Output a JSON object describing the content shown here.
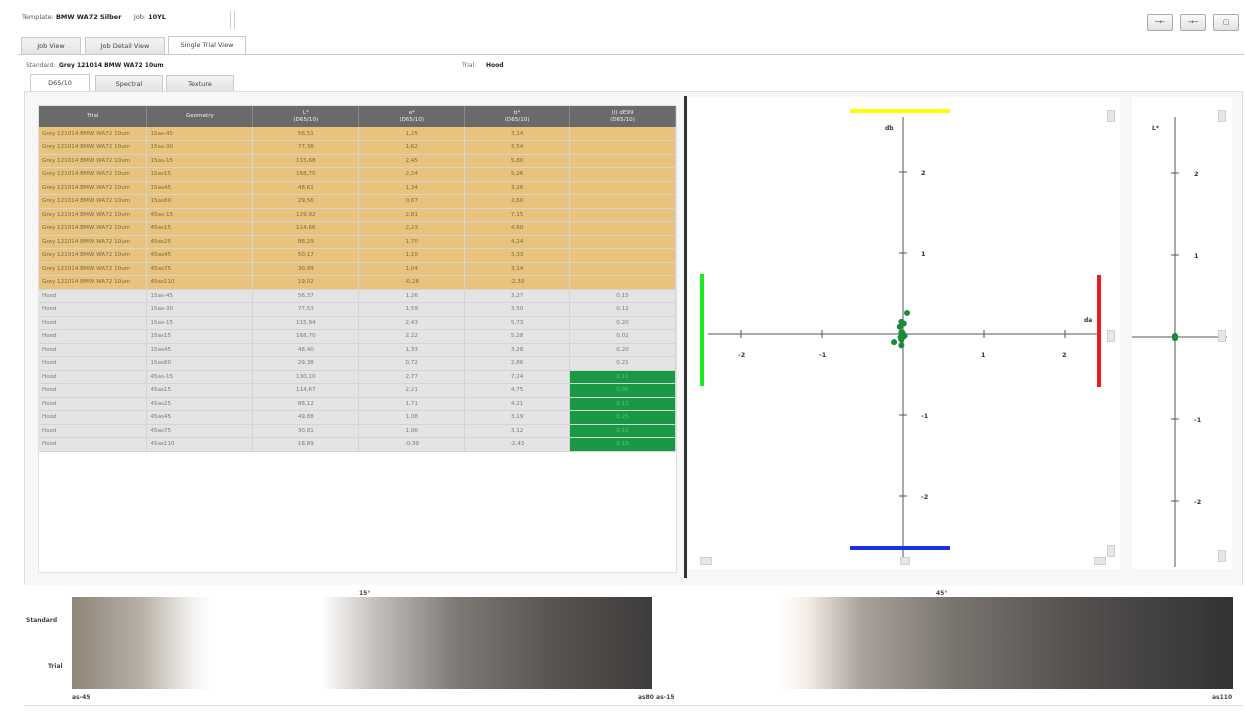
{
  "header": {
    "template_label": "Template:",
    "template_value": "BMW WA72 Silber",
    "job_label": "Job:",
    "job_value": "10YL",
    "tool_buttons": [
      "─←",
      "→─",
      "▢"
    ]
  },
  "tabs": [
    "Job View",
    "Job Detail View",
    "Single Trial View"
  ],
  "standard_label": "Standard:",
  "standard_value": "Grey 121014 BMW WA72 10um",
  "trial_label": "Trial:",
  "trial_value": "Hood",
  "subtabs": [
    "D65/10",
    "Spectral",
    "Texture"
  ],
  "table": {
    "headers": [
      {
        "l1": "Trial",
        "l2": ""
      },
      {
        "l1": "Geometry",
        "l2": ""
      },
      {
        "l1": "L*",
        "l2": "(D65/10)"
      },
      {
        "l1": "a*",
        "l2": "(D65/10)"
      },
      {
        "l1": "b*",
        "l2": "(D65/10)"
      },
      {
        "l1": "(I) dE99",
        "l2": "(D65/10)"
      }
    ],
    "rows": [
      {
        "trial": "Grey 121014 BMW WA72 10um",
        "geo": "15as-45",
        "L": "56,51",
        "a": "1,25",
        "b": "3,14",
        "de": "",
        "kind": "std"
      },
      {
        "trial": "Grey 121014 BMW WA72 10um",
        "geo": "15as-30",
        "L": "77,38",
        "a": "1,62",
        "b": "3,54",
        "de": "",
        "kind": "std"
      },
      {
        "trial": "Grey 121014 BMW WA72 10um",
        "geo": "15as-15",
        "L": "115,68",
        "a": "2,45",
        "b": "5,80",
        "de": "",
        "kind": "std"
      },
      {
        "trial": "Grey 121014 BMW WA72 10um",
        "geo": "15as15",
        "L": "168,70",
        "a": "2,24",
        "b": "5,26",
        "de": "",
        "kind": "std"
      },
      {
        "trial": "Grey 121014 BMW WA72 10um",
        "geo": "15as45",
        "L": "48,61",
        "a": "1,34",
        "b": "3,26",
        "de": "",
        "kind": "std"
      },
      {
        "trial": "Grey 121014 BMW WA72 10um",
        "geo": "15as80",
        "L": "29,56",
        "a": "0,67",
        "b": "2,60",
        "de": "",
        "kind": "std"
      },
      {
        "trial": "Grey 121014 BMW WA72 10um",
        "geo": "45as-15",
        "L": "129,92",
        "a": "2,81",
        "b": "7,15",
        "de": "",
        "kind": "std"
      },
      {
        "trial": "Grey 121014 BMW WA72 10um",
        "geo": "45as15",
        "L": "114,66",
        "a": "2,23",
        "b": "4,60",
        "de": "",
        "kind": "std"
      },
      {
        "trial": "Grey 121014 BMW WA72 10um",
        "geo": "45as25",
        "L": "88,29",
        "a": "1,70",
        "b": "4,24",
        "de": "",
        "kind": "std"
      },
      {
        "trial": "Grey 121014 BMW WA72 10um",
        "geo": "45as45",
        "L": "50,17",
        "a": "1,10",
        "b": "3,33",
        "de": "",
        "kind": "std"
      },
      {
        "trial": "Grey 121014 BMW WA72 10um",
        "geo": "45as75",
        "L": "30,99",
        "a": "1,04",
        "b": "3,14",
        "de": "",
        "kind": "std"
      },
      {
        "trial": "Grey 121014 BMW WA72 10um",
        "geo": "45as110",
        "L": "19,02",
        "a": "-0,28",
        "b": "-2,33",
        "de": "",
        "kind": "std"
      },
      {
        "trial": "Hood",
        "geo": "15as-45",
        "L": "56,37",
        "a": "1,26",
        "b": "3,27",
        "de": "0,15",
        "kind": "trl"
      },
      {
        "trial": "Hood",
        "geo": "15as-30",
        "L": "77,53",
        "a": "1,59",
        "b": "3,50",
        "de": "0,12",
        "kind": "trl"
      },
      {
        "trial": "Hood",
        "geo": "15as-15",
        "L": "115,94",
        "a": "2,43",
        "b": "5,73",
        "de": "0,20",
        "kind": "trl"
      },
      {
        "trial": "Hood",
        "geo": "15as15",
        "L": "168,70",
        "a": "2,22",
        "b": "5,28",
        "de": "0,02",
        "kind": "trl"
      },
      {
        "trial": "Hood",
        "geo": "15as45",
        "L": "48,40",
        "a": "1,33",
        "b": "3,28",
        "de": "0,20",
        "kind": "trl"
      },
      {
        "trial": "Hood",
        "geo": "15as80",
        "L": "29,38",
        "a": "0,72",
        "b": "2,86",
        "de": "0,21",
        "kind": "trl"
      },
      {
        "trial": "Hood",
        "geo": "45as-15",
        "L": "130,10",
        "a": "2,77",
        "b": "7,24",
        "de": "0,11",
        "kind": "trl",
        "green": true
      },
      {
        "trial": "Hood",
        "geo": "45as15",
        "L": "114,67",
        "a": "2,21",
        "b": "4,75",
        "de": "0,05",
        "kind": "trl",
        "green": true
      },
      {
        "trial": "Hood",
        "geo": "45as25",
        "L": "88,12",
        "a": "1,71",
        "b": "4,21",
        "de": "0,12",
        "kind": "trl",
        "green": true
      },
      {
        "trial": "Hood",
        "geo": "45as45",
        "L": "49,88",
        "a": "1,08",
        "b": "3,19",
        "de": "0,25",
        "kind": "trl",
        "green": true
      },
      {
        "trial": "Hood",
        "geo": "45as75",
        "L": "30,81",
        "a": "1,06",
        "b": "3,12",
        "de": "0,15",
        "kind": "trl",
        "green": true
      },
      {
        "trial": "Hood",
        "geo": "45as110",
        "L": "18,89",
        "a": "-0,39",
        "b": "-2,43",
        "de": "0,18",
        "kind": "trl",
        "green": true
      }
    ]
  },
  "plot_ab": {
    "x_ticks": [
      "-2",
      "-1",
      "1",
      "2"
    ],
    "y_ticks": [
      "2",
      "1",
      "-1",
      "-2"
    ],
    "y_axis_label": "db",
    "x_axis_label": "da",
    "colors": {
      "yellow": "#ffff00",
      "blue": "#1a2fe6",
      "green": "#1ee81e",
      "red": "#ea1d1d",
      "point": "#1a8a3d"
    }
  },
  "plot_l": {
    "y_ticks": [
      "2",
      "1",
      "-1",
      "-2"
    ],
    "y_axis_label": "L*"
  },
  "swatches": {
    "group_15": "15°",
    "group_45": "45°",
    "row_standard": "Standard",
    "row_trial": "Trial",
    "label_left": "as-45",
    "label_mid": "as80 as-15",
    "label_right": "as110"
  }
}
